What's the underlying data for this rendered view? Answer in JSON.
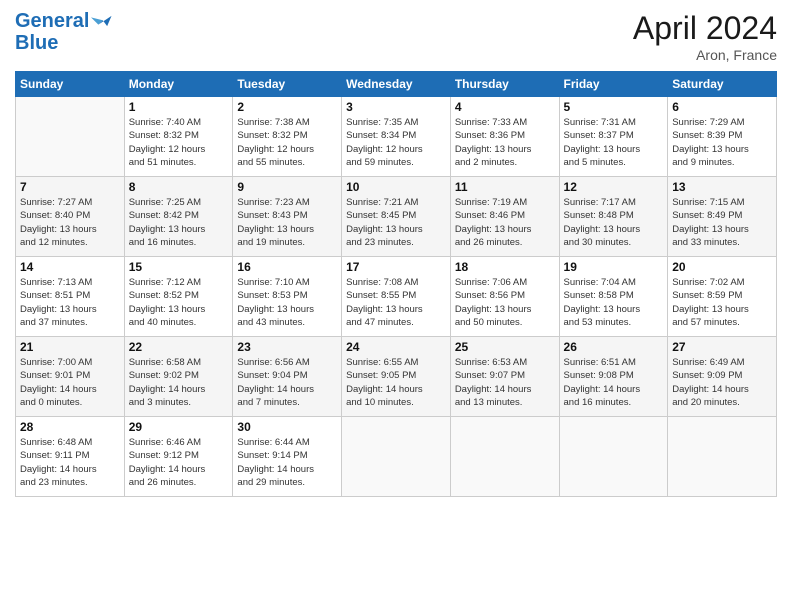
{
  "logo": {
    "line1": "General",
    "line2": "Blue"
  },
  "title": "April 2024",
  "subtitle": "Aron, France",
  "headers": [
    "Sunday",
    "Monday",
    "Tuesday",
    "Wednesday",
    "Thursday",
    "Friday",
    "Saturday"
  ],
  "weeks": [
    [
      {
        "day": "",
        "info": ""
      },
      {
        "day": "1",
        "info": "Sunrise: 7:40 AM\nSunset: 8:32 PM\nDaylight: 12 hours\nand 51 minutes."
      },
      {
        "day": "2",
        "info": "Sunrise: 7:38 AM\nSunset: 8:32 PM\nDaylight: 12 hours\nand 55 minutes."
      },
      {
        "day": "3",
        "info": "Sunrise: 7:35 AM\nSunset: 8:34 PM\nDaylight: 12 hours\nand 59 minutes."
      },
      {
        "day": "4",
        "info": "Sunrise: 7:33 AM\nSunset: 8:36 PM\nDaylight: 13 hours\nand 2 minutes."
      },
      {
        "day": "5",
        "info": "Sunrise: 7:31 AM\nSunset: 8:37 PM\nDaylight: 13 hours\nand 5 minutes."
      },
      {
        "day": "6",
        "info": "Sunrise: 7:29 AM\nSunset: 8:39 PM\nDaylight: 13 hours\nand 9 minutes."
      }
    ],
    [
      {
        "day": "7",
        "info": "Sunrise: 7:27 AM\nSunset: 8:40 PM\nDaylight: 13 hours\nand 12 minutes."
      },
      {
        "day": "8",
        "info": "Sunrise: 7:25 AM\nSunset: 8:42 PM\nDaylight: 13 hours\nand 16 minutes."
      },
      {
        "day": "9",
        "info": "Sunrise: 7:23 AM\nSunset: 8:43 PM\nDaylight: 13 hours\nand 19 minutes."
      },
      {
        "day": "10",
        "info": "Sunrise: 7:21 AM\nSunset: 8:45 PM\nDaylight: 13 hours\nand 23 minutes."
      },
      {
        "day": "11",
        "info": "Sunrise: 7:19 AM\nSunset: 8:46 PM\nDaylight: 13 hours\nand 26 minutes."
      },
      {
        "day": "12",
        "info": "Sunrise: 7:17 AM\nSunset: 8:48 PM\nDaylight: 13 hours\nand 30 minutes."
      },
      {
        "day": "13",
        "info": "Sunrise: 7:15 AM\nSunset: 8:49 PM\nDaylight: 13 hours\nand 33 minutes."
      }
    ],
    [
      {
        "day": "14",
        "info": "Sunrise: 7:13 AM\nSunset: 8:51 PM\nDaylight: 13 hours\nand 37 minutes."
      },
      {
        "day": "15",
        "info": "Sunrise: 7:12 AM\nSunset: 8:52 PM\nDaylight: 13 hours\nand 40 minutes."
      },
      {
        "day": "16",
        "info": "Sunrise: 7:10 AM\nSunset: 8:53 PM\nDaylight: 13 hours\nand 43 minutes."
      },
      {
        "day": "17",
        "info": "Sunrise: 7:08 AM\nSunset: 8:55 PM\nDaylight: 13 hours\nand 47 minutes."
      },
      {
        "day": "18",
        "info": "Sunrise: 7:06 AM\nSunset: 8:56 PM\nDaylight: 13 hours\nand 50 minutes."
      },
      {
        "day": "19",
        "info": "Sunrise: 7:04 AM\nSunset: 8:58 PM\nDaylight: 13 hours\nand 53 minutes."
      },
      {
        "day": "20",
        "info": "Sunrise: 7:02 AM\nSunset: 8:59 PM\nDaylight: 13 hours\nand 57 minutes."
      }
    ],
    [
      {
        "day": "21",
        "info": "Sunrise: 7:00 AM\nSunset: 9:01 PM\nDaylight: 14 hours\nand 0 minutes."
      },
      {
        "day": "22",
        "info": "Sunrise: 6:58 AM\nSunset: 9:02 PM\nDaylight: 14 hours\nand 3 minutes."
      },
      {
        "day": "23",
        "info": "Sunrise: 6:56 AM\nSunset: 9:04 PM\nDaylight: 14 hours\nand 7 minutes."
      },
      {
        "day": "24",
        "info": "Sunrise: 6:55 AM\nSunset: 9:05 PM\nDaylight: 14 hours\nand 10 minutes."
      },
      {
        "day": "25",
        "info": "Sunrise: 6:53 AM\nSunset: 9:07 PM\nDaylight: 14 hours\nand 13 minutes."
      },
      {
        "day": "26",
        "info": "Sunrise: 6:51 AM\nSunset: 9:08 PM\nDaylight: 14 hours\nand 16 minutes."
      },
      {
        "day": "27",
        "info": "Sunrise: 6:49 AM\nSunset: 9:09 PM\nDaylight: 14 hours\nand 20 minutes."
      }
    ],
    [
      {
        "day": "28",
        "info": "Sunrise: 6:48 AM\nSunset: 9:11 PM\nDaylight: 14 hours\nand 23 minutes."
      },
      {
        "day": "29",
        "info": "Sunrise: 6:46 AM\nSunset: 9:12 PM\nDaylight: 14 hours\nand 26 minutes."
      },
      {
        "day": "30",
        "info": "Sunrise: 6:44 AM\nSunset: 9:14 PM\nDaylight: 14 hours\nand 29 minutes."
      },
      {
        "day": "",
        "info": ""
      },
      {
        "day": "",
        "info": ""
      },
      {
        "day": "",
        "info": ""
      },
      {
        "day": "",
        "info": ""
      }
    ]
  ]
}
